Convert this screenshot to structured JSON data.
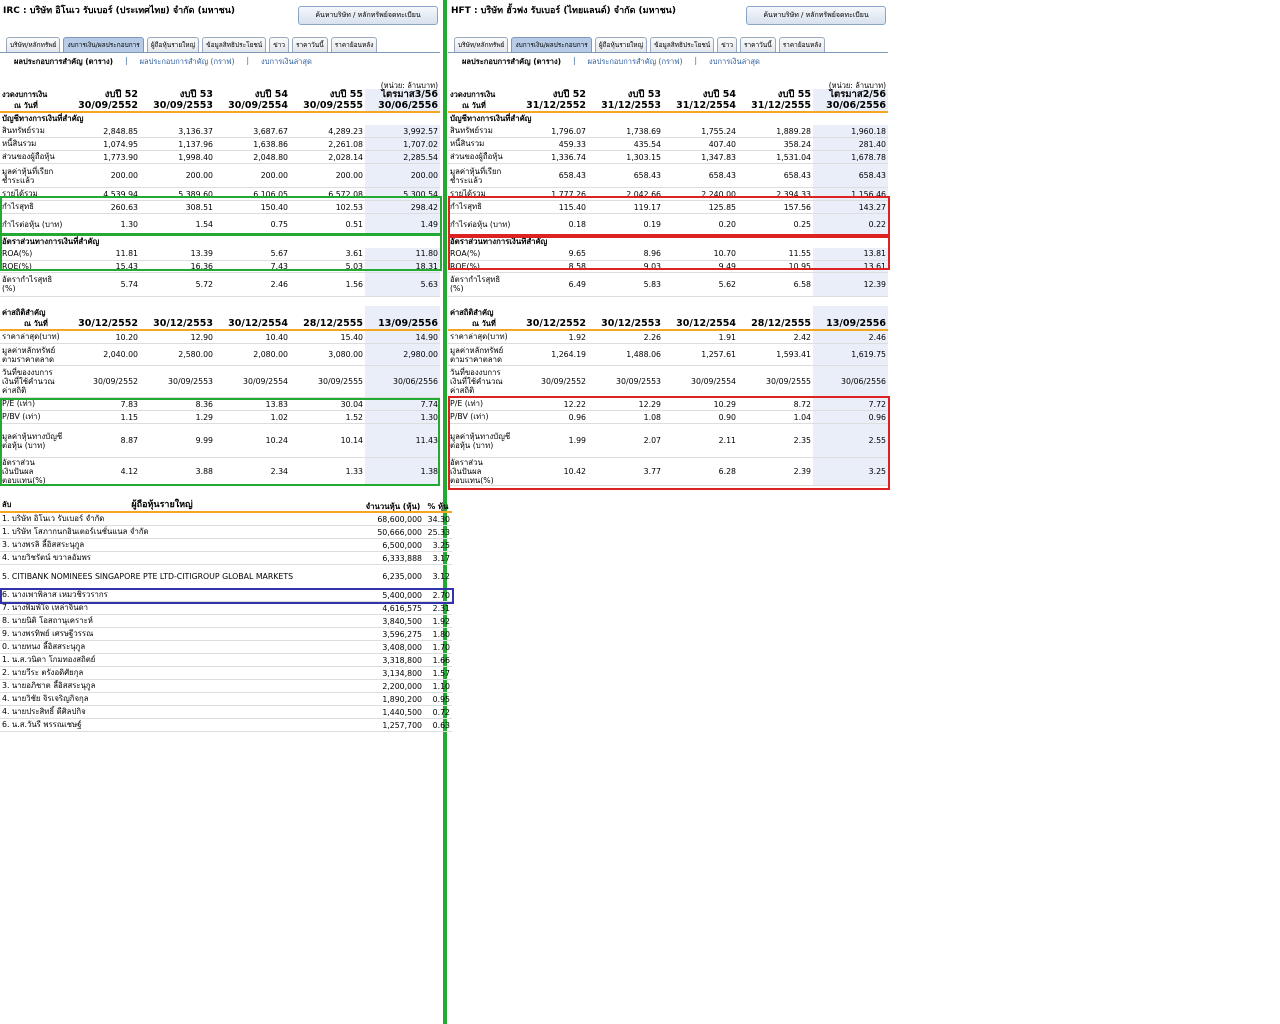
{
  "left": {
    "title": "IRC : บริษัท อิโนเว รับเบอร์ (ประเทศไทย) จำกัด (มหาชน)",
    "search_button": "ค้นหาบริษัท / หลักทรัพย์จดทะเบียน",
    "tabs": [
      "บริษัท/หลักทรัพย์",
      "งบการเงิน/ผลประกอบการ",
      "ผู้ถือหุ้นรายใหญ่",
      "ข้อมูลสิทธิประโยชน์",
      "ข่าว",
      "ราคาวันนี้",
      "ราคาย้อนหลัง"
    ],
    "subtabs": [
      "ผลประกอบการสำคัญ (ตาราง)",
      "ผลประกอบการสำคัญ (กราฟ)",
      "งบการเงินล่าสุด"
    ],
    "unit_note": "(หน่วย: ล้านบาท)",
    "fin_header": {
      "label1": "งวดงบการเงิน",
      "label2": "ณ วันที่",
      "cols": [
        [
          "งบปี 52",
          "30/09/2552"
        ],
        [
          "งบปี 53",
          "30/09/2553"
        ],
        [
          "งบปี 54",
          "30/09/2554"
        ],
        [
          "งบปี 55",
          "30/09/2555"
        ],
        [
          "ไตรมาส3/56",
          "30/06/2556"
        ]
      ]
    },
    "section_accounts": "บัญชีทางการเงินที่สำคัญ",
    "accounts": [
      {
        "label": "สินทรัพย์รวม",
        "values": [
          "2,848.85",
          "3,136.37",
          "3,687.67",
          "4,289.23",
          "3,992.57"
        ]
      },
      {
        "label": "หนี้สินรวม",
        "values": [
          "1,074.95",
          "1,137.96",
          "1,638.86",
          "2,261.08",
          "1,707.02"
        ]
      },
      {
        "label": "ส่วนของผู้ถือหุ้น",
        "values": [
          "1,773.90",
          "1,998.40",
          "2,048.80",
          "2,028.14",
          "2,285.54"
        ]
      },
      {
        "label": "มูลค่าหุ้นที่เรียกชำระแล้ว",
        "values": [
          "200.00",
          "200.00",
          "200.00",
          "200.00",
          "200.00"
        ]
      },
      {
        "label": "รายได้รวม",
        "values": [
          "4,539.94",
          "5,389.60",
          "6,106.05",
          "6,572.08",
          "5,300.54"
        ]
      },
      {
        "label": "กำไรสุทธิ",
        "values": [
          "260.63",
          "308.51",
          "150.40",
          "102.53",
          "298.42"
        ]
      },
      {
        "label": "กำไรต่อหุ้น (บาท)",
        "values": [
          "1.30",
          "1.54",
          "0.75",
          "0.51",
          "1.49"
        ]
      }
    ],
    "section_ratios": "อัตราส่วนทางการเงินที่สำคัญ",
    "ratios": [
      {
        "label": "ROA(%)",
        "values": [
          "11.81",
          "13.39",
          "5.67",
          "3.61",
          "11.80"
        ]
      },
      {
        "label": "ROE(%)",
        "values": [
          "15.43",
          "16.36",
          "7.43",
          "5.03",
          "18.31"
        ]
      },
      {
        "label": "อัตรากำไรสุทธิ (%)",
        "values": [
          "5.74",
          "5.72",
          "2.46",
          "1.56",
          "5.63"
        ]
      }
    ],
    "stat_header": {
      "label1": "ค่าสถิติสำคัญ",
      "label2": "ณ วันที่",
      "cols": [
        "30/12/2552",
        "30/12/2553",
        "30/12/2554",
        "28/12/2555",
        "13/09/2556"
      ]
    },
    "stats": [
      {
        "label": "ราคาล่าสุด(บาท)",
        "values": [
          "10.20",
          "12.90",
          "10.40",
          "15.40",
          "14.90"
        ]
      },
      {
        "label": "มูลค่าหลักทรัพย์ตามราคาตลาด",
        "values": [
          "2,040.00",
          "2,580.00",
          "2,080.00",
          "3,080.00",
          "2,980.00"
        ]
      },
      {
        "label": "วันที่ของงบการเงินที่ใช้คำนวณค่าสถิติ",
        "values": [
          "30/09/2552",
          "30/09/2553",
          "30/09/2554",
          "30/09/2555",
          "30/06/2556"
        ]
      },
      {
        "label": "P/E (เท่า)",
        "values": [
          "7.83",
          "8.36",
          "13.83",
          "30.04",
          "7.74"
        ]
      },
      {
        "label": "P/BV (เท่า)",
        "values": [
          "1.15",
          "1.29",
          "1.02",
          "1.52",
          "1.30"
        ]
      },
      {
        "label": "มูลค่าหุ้นทางบัญชีต่อหุ้น (บาท)",
        "values": [
          "8.87",
          "9.99",
          "10.24",
          "10.14",
          "11.43"
        ]
      },
      {
        "label": "อัตราส่วนเงินปันผลตอบแทน(%)",
        "values": [
          "4.12",
          "3.88",
          "2.34",
          "1.33",
          "1.38"
        ]
      }
    ],
    "holders_header": {
      "rank": "ลับ",
      "name": "ผู้ถือหุ้นรายใหญ่",
      "shares": "จำนวนหุ้น (หุ้น)",
      "pct": "% หุ้น"
    },
    "holders": [
      {
        "name": "1. บริษัท อิโนเว รับเบอร์ จำกัด",
        "shares": "68,600,000",
        "pct": "34.30"
      },
      {
        "name": "1. บริษัท โสภากนกอินเตอร์เนชั่นแนล จำกัด",
        "shares": "50,666,000",
        "pct": "25.33"
      },
      {
        "name": "3. นางพรลิ ลี้อิสสระนุกูล",
        "shares": "6,500,000",
        "pct": "3.25"
      },
      {
        "name": "4. นายวิชรัตน์ ขวาลอัมพร",
        "shares": "6,333,888",
        "pct": "3.17"
      },
      {
        "name": "5. CITIBANK NOMINEES SINGAPORE PTE LTD-CITIGROUP GLOBAL MARKETS",
        "shares": "6,235,000",
        "pct": "3.12"
      },
      {
        "name": "6. นางเพาพิลาส เหมวชิรวรากร",
        "shares": "5,400,000",
        "pct": "2.70"
      },
      {
        "name": "7. นางพิมพ์ใจ เหล่าจินดา",
        "shares": "4,616,575",
        "pct": "2.31"
      },
      {
        "name": "8. นายนิติ โอสถานุเคราะห์",
        "shares": "3,840,500",
        "pct": "1.92"
      },
      {
        "name": "9. นางพรทิพย์ เศรษฐีวรรณ",
        "shares": "3,596,275",
        "pct": "1.80"
      },
      {
        "name": "0. นายทนง ลี้อิสสระนุกูล",
        "shares": "3,408,000",
        "pct": "1.70"
      },
      {
        "name": "1. น.ส.วนิดา โกมทองสถิตย์",
        "shares": "3,318,800",
        "pct": "1.66"
      },
      {
        "name": "2. นายวีระ ตรังอดิศัยกุล",
        "shares": "3,134,800",
        "pct": "1.57"
      },
      {
        "name": "3. นายอภิชาต ลี้อิสสระนุกูล",
        "shares": "2,200,000",
        "pct": "1.10"
      },
      {
        "name": "4. นายวิชัย จิรเจริญกิจกุล",
        "shares": "1,890,200",
        "pct": "0.95"
      },
      {
        "name": "4. นายประสิทธิ์ ดีศิลปกิจ",
        "shares": "1,440,500",
        "pct": "0.72"
      },
      {
        "name": "6. น.ส.วันรี พรรณเชษฐ์",
        "shares": "1,257,700",
        "pct": "0.63"
      }
    ]
  },
  "right": {
    "title": "HFT : บริษัท ฮั้วฟง รับเบอร์ (ไทยแลนด์) จำกัด (มหาชน)",
    "search_button": "ค้นหาบริษัท / หลักทรัพย์จดทะเบียน",
    "tabs": [
      "บริษัท/หลักทรัพย์",
      "งบการเงิน/ผลประกอบการ",
      "ผู้ถือหุ้นรายใหญ่",
      "ข้อมูลสิทธิประโยชน์",
      "ข่าว",
      "ราคาวันนี้",
      "ราคาย้อนหลัง"
    ],
    "subtabs": [
      "ผลประกอบการสำคัญ (ตาราง)",
      "ผลประกอบการสำคัญ (กราฟ)",
      "งบการเงินล่าสุด"
    ],
    "unit_note": "(หน่วย: ล้านบาท)",
    "fin_header": {
      "label1": "งวดงบการเงิน",
      "label2": "ณ วันที่",
      "cols": [
        [
          "งบปี 52",
          "31/12/2552"
        ],
        [
          "งบปี 53",
          "31/12/2553"
        ],
        [
          "งบปี 54",
          "31/12/2554"
        ],
        [
          "งบปี 55",
          "31/12/2555"
        ],
        [
          "ไตรมาส2/56",
          "30/06/2556"
        ]
      ]
    },
    "section_accounts": "บัญชีทางการเงินที่สำคัญ",
    "accounts": [
      {
        "label": "สินทรัพย์รวม",
        "values": [
          "1,796.07",
          "1,738.69",
          "1,755.24",
          "1,889.28",
          "1,960.18"
        ]
      },
      {
        "label": "หนี้สินรวม",
        "values": [
          "459.33",
          "435.54",
          "407.40",
          "358.24",
          "281.40"
        ]
      },
      {
        "label": "ส่วนของผู้ถือหุ้น",
        "values": [
          "1,336.74",
          "1,303.15",
          "1,347.83",
          "1,531.04",
          "1,678.78"
        ]
      },
      {
        "label": "มูลค่าหุ้นที่เรียกชำระแล้ว",
        "values": [
          "658.43",
          "658.43",
          "658.43",
          "658.43",
          "658.43"
        ]
      },
      {
        "label": "รายได้รวม",
        "values": [
          "1,777.26",
          "2,042.66",
          "2,240.00",
          "2,394.33",
          "1,156.46"
        ]
      },
      {
        "label": "กำไรสุทธิ",
        "values": [
          "115.40",
          "119.17",
          "125.85",
          "157.56",
          "143.27"
        ]
      },
      {
        "label": "กำไรต่อหุ้น (บาท)",
        "values": [
          "0.18",
          "0.19",
          "0.20",
          "0.25",
          "0.22"
        ]
      }
    ],
    "section_ratios": "อัตราส่วนทางการเงินที่สำคัญ",
    "ratios": [
      {
        "label": "ROA(%)",
        "values": [
          "9.65",
          "8.96",
          "10.70",
          "11.55",
          "13.81"
        ]
      },
      {
        "label": "ROE(%)",
        "values": [
          "8.58",
          "9.03",
          "9.49",
          "10.95",
          "13.61"
        ]
      },
      {
        "label": "อัตรากำไรสุทธิ (%)",
        "values": [
          "6.49",
          "5.83",
          "5.62",
          "6.58",
          "12.39"
        ]
      }
    ],
    "stat_header": {
      "label1": "ค่าสถิติสำคัญ",
      "label2": "ณ วันที่",
      "cols": [
        "30/12/2552",
        "30/12/2553",
        "30/12/2554",
        "28/12/2555",
        "13/09/2556"
      ]
    },
    "stats": [
      {
        "label": "ราคาล่าสุด(บาท)",
        "values": [
          "1.92",
          "2.26",
          "1.91",
          "2.42",
          "2.46"
        ]
      },
      {
        "label": "มูลค่าหลักทรัพย์ตามราคาตลาด",
        "values": [
          "1,264.19",
          "1,488.06",
          "1,257.61",
          "1,593.41",
          "1,619.75"
        ]
      },
      {
        "label": "วันที่ของงบการเงินที่ใช้คำนวณค่าสถิติ",
        "values": [
          "30/09/2552",
          "30/09/2553",
          "30/09/2554",
          "30/09/2555",
          "30/06/2556"
        ]
      },
      {
        "label": "P/E (เท่า)",
        "values": [
          "12.22",
          "12.29",
          "10.29",
          "8.72",
          "7.72"
        ]
      },
      {
        "label": "P/BV (เท่า)",
        "values": [
          "0.96",
          "1.08",
          "0.90",
          "1.04",
          "0.96"
        ]
      },
      {
        "label": "มูลค่าหุ้นทางบัญชีต่อหุ้น (บาท)",
        "values": [
          "1.99",
          "2.07",
          "2.11",
          "2.35",
          "2.55"
        ]
      },
      {
        "label": "อัตราส่วนเงินปันผลตอบแทน(%)",
        "values": [
          "10.42",
          "3.77",
          "6.28",
          "2.39",
          "3.25"
        ]
      }
    ]
  }
}
